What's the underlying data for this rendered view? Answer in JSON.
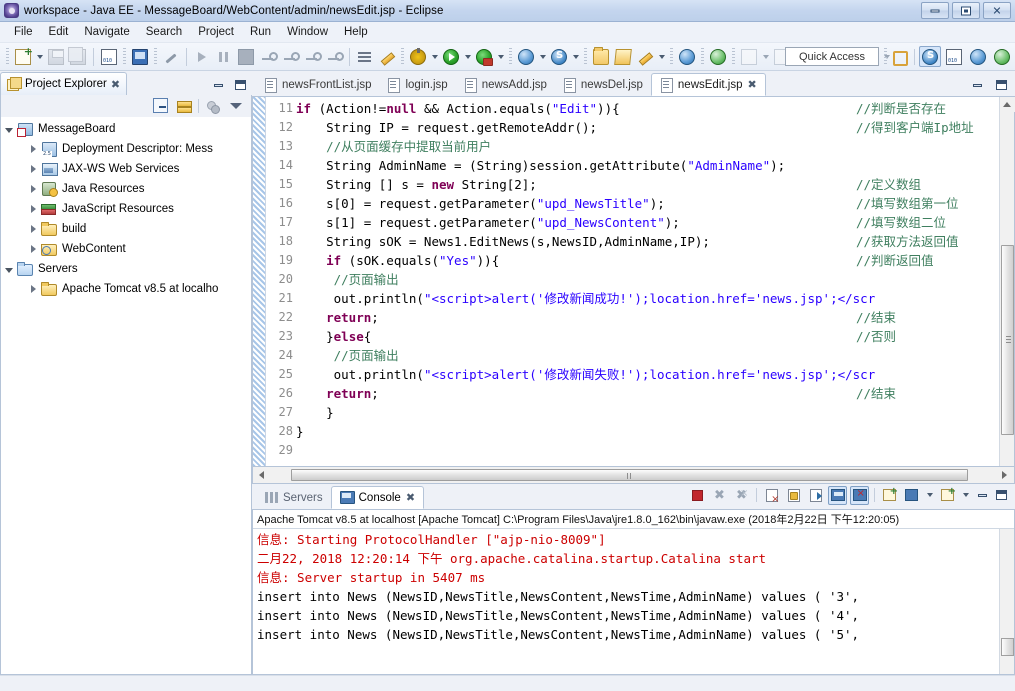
{
  "window": {
    "title": "workspace - Java EE - MessageBoard/WebContent/admin/newsEdit.jsp - Eclipse",
    "app_icon": "eclipse-icon",
    "minimize": "–",
    "maximize": "□",
    "close": "✕"
  },
  "menubar": {
    "items": [
      {
        "label": "File"
      },
      {
        "label": "Edit"
      },
      {
        "label": "Navigate"
      },
      {
        "label": "Search"
      },
      {
        "label": "Project"
      },
      {
        "label": "Run"
      },
      {
        "label": "Window"
      },
      {
        "label": "Help"
      }
    ]
  },
  "toolbar": {
    "quick_access": "Quick Access",
    "icons": [
      "new-wizard-icon",
      "save-icon",
      "save-all-icon",
      "binary-editor-icon",
      "open-console-icon",
      "toggle-breakpoint-icon",
      "resume-icon",
      "suspend-icon",
      "terminate-icon",
      "step-into-icon",
      "step-over-icon",
      "step-return-icon",
      "drop-to-frame-icon",
      "next-annotation-icon",
      "previous-annotation-icon",
      "debug-icon",
      "run-icon",
      "run-server-icon",
      "new-web-project-icon",
      "new-server-icon",
      "open-type-icon",
      "open-task-icon",
      "search-icon",
      "web-browser-icon",
      "run-as-icon",
      "annotation-icon",
      "next-edit-icon",
      "back-icon",
      "forward-icon"
    ],
    "perspective_icons": [
      "open-perspective-icon",
      "java-ee-perspective-icon",
      "java-perspective-icon",
      "debug-perspective-icon",
      "web-perspective-icon"
    ]
  },
  "project_explorer": {
    "tab_label": "Project Explorer",
    "tab_icon": "project-explorer-icon",
    "close_icon": "✖",
    "toolbar_icons": [
      "collapse-all-icon",
      "link-with-editor-icon",
      "filter-icon",
      "view-menu-icon"
    ],
    "tree": [
      {
        "label": "MessageBoard",
        "icon": "project-icon",
        "indent": 0,
        "arrow": "open"
      },
      {
        "label": "Deployment Descriptor: Mess",
        "icon": "deployment-descriptor-icon",
        "indent": 1,
        "arrow": "closed"
      },
      {
        "label": "JAX-WS Web Services",
        "icon": "web-services-icon",
        "indent": 1,
        "arrow": "closed"
      },
      {
        "label": "Java Resources",
        "icon": "java-resources-icon",
        "indent": 1,
        "arrow": "closed"
      },
      {
        "label": "JavaScript Resources",
        "icon": "javascript-resources-icon",
        "indent": 1,
        "arrow": "closed"
      },
      {
        "label": "build",
        "icon": "folder-icon",
        "indent": 1,
        "arrow": "closed"
      },
      {
        "label": "WebContent",
        "icon": "web-folder-icon",
        "indent": 1,
        "arrow": "closed"
      },
      {
        "label": "Servers",
        "icon": "folder-blue-icon",
        "indent": 0,
        "arrow": "open"
      },
      {
        "label": "Apache Tomcat v8.5 at localho",
        "icon": "folder-icon",
        "indent": 1,
        "arrow": "closed"
      }
    ]
  },
  "editor": {
    "tabs": [
      {
        "label": "newsFrontList.jsp",
        "active": false
      },
      {
        "label": "login.jsp",
        "active": false
      },
      {
        "label": "newsAdd.jsp",
        "active": false
      },
      {
        "label": "newsDel.jsp",
        "active": false
      },
      {
        "label": "newsEdit.jsp",
        "active": true
      }
    ],
    "close_icon": "✖",
    "line_numbers": [
      11,
      12,
      13,
      14,
      15,
      16,
      17,
      18,
      19,
      20,
      21,
      22,
      23,
      24,
      25,
      26,
      27,
      28,
      29
    ],
    "lines": [
      {
        "num": 11,
        "segments": [
          {
            "t": "if ",
            "c": "kw"
          },
          {
            "t": "(Action!=",
            "c": "plain"
          },
          {
            "t": "null",
            "c": "kw"
          },
          {
            "t": " && Action.equals(",
            "c": "plain"
          },
          {
            "t": "\"Edit\"",
            "c": "str"
          },
          {
            "t": ")){",
            "c": "plain"
          }
        ],
        "comment": "//判断是否存在"
      },
      {
        "num": 12,
        "segments": [
          {
            "t": "    String IP = request.getRemoteAddr();",
            "c": "plain"
          }
        ],
        "comment": "//得到客户端Ip地址"
      },
      {
        "num": 13,
        "segments": [
          {
            "t": "    //从页面缓存中提取当前用户",
            "c": "cmt"
          }
        ],
        "comment": ""
      },
      {
        "num": 14,
        "segments": [
          {
            "t": "    String AdminName = (String)session.getAttribute(",
            "c": "plain"
          },
          {
            "t": "\"AdminName\"",
            "c": "str"
          },
          {
            "t": ");",
            "c": "plain"
          }
        ],
        "comment": ""
      },
      {
        "num": 15,
        "segments": [
          {
            "t": "    String [] s = ",
            "c": "plain"
          },
          {
            "t": "new",
            "c": "kw"
          },
          {
            "t": " String[2];",
            "c": "plain"
          }
        ],
        "comment": "//定义数组"
      },
      {
        "num": 16,
        "segments": [
          {
            "t": "    s[0] = request.getParameter(",
            "c": "plain"
          },
          {
            "t": "\"upd_NewsTitle\"",
            "c": "str"
          },
          {
            "t": ");",
            "c": "plain"
          }
        ],
        "comment": "//填写数组第一位"
      },
      {
        "num": 17,
        "segments": [
          {
            "t": "    s[1] = request.getParameter(",
            "c": "plain"
          },
          {
            "t": "\"upd_NewsContent\"",
            "c": "str"
          },
          {
            "t": ");",
            "c": "plain"
          }
        ],
        "comment": "//填写数组二位"
      },
      {
        "num": 18,
        "segments": [
          {
            "t": "    String sOK = News1.EditNews(s,NewsID,AdminName,IP);",
            "c": "plain"
          }
        ],
        "comment": "//获取方法返回值"
      },
      {
        "num": 19,
        "segments": [
          {
            "t": "    if",
            "c": "kw"
          },
          {
            "t": " (sOK.equals(",
            "c": "plain"
          },
          {
            "t": "\"Yes\"",
            "c": "str"
          },
          {
            "t": ")){",
            "c": "plain"
          }
        ],
        "comment": "//判断返回值"
      },
      {
        "num": 20,
        "segments": [
          {
            "t": "     //页面输出",
            "c": "cmt"
          }
        ],
        "comment": ""
      },
      {
        "num": 21,
        "segments": [
          {
            "t": "     out.println(",
            "c": "plain"
          },
          {
            "t": "\"<script>alert('修改新闻成功!');location.href='news.jsp';</scr",
            "c": "str"
          }
        ],
        "comment": ""
      },
      {
        "num": 22,
        "segments": [
          {
            "t": "    return",
            "c": "kw"
          },
          {
            "t": ";",
            "c": "plain"
          }
        ],
        "comment": "//结束"
      },
      {
        "num": 23,
        "segments": [
          {
            "t": "    }",
            "c": "plain"
          },
          {
            "t": "else",
            "c": "kw"
          },
          {
            "t": "{",
            "c": "plain"
          }
        ],
        "comment": "//否则"
      },
      {
        "num": 24,
        "segments": [
          {
            "t": "     //页面输出",
            "c": "cmt"
          }
        ],
        "comment": ""
      },
      {
        "num": 25,
        "segments": [
          {
            "t": "     out.println(",
            "c": "plain"
          },
          {
            "t": "\"<script>alert('修改新闻失败!');location.href='news.jsp';</scr",
            "c": "str"
          }
        ],
        "comment": ""
      },
      {
        "num": 26,
        "segments": [
          {
            "t": "    return",
            "c": "kw"
          },
          {
            "t": ";",
            "c": "plain"
          }
        ],
        "comment": "//结束"
      },
      {
        "num": 27,
        "segments": [
          {
            "t": "    }",
            "c": "plain"
          }
        ],
        "comment": ""
      },
      {
        "num": 28,
        "segments": [
          {
            "t": "}",
            "c": "plain"
          }
        ],
        "comment": ""
      },
      {
        "num": 29,
        "segments": [
          {
            "t": "",
            "c": "plain"
          }
        ],
        "comment": ""
      }
    ]
  },
  "console": {
    "tabs": [
      {
        "label": "Servers",
        "icon": "servers-icon",
        "active": false
      },
      {
        "label": "Console",
        "icon": "console-icon",
        "active": true
      }
    ],
    "close_icon": "✖",
    "toolbar_icons": [
      "terminate-icon",
      "remove-launch-icon",
      "remove-all-launches-icon",
      "clear-console-icon",
      "scroll-lock-icon",
      "word-wrap-icon",
      "show-console-icon",
      "display-selected-console-icon",
      "pin-console-icon",
      "open-console-icon",
      "new-console-view-icon"
    ],
    "header": "Apache Tomcat v8.5 at localhost [Apache Tomcat] C:\\Program Files\\Java\\jre1.8.0_162\\bin\\javaw.exe (2018年2月22日 下午12:20:05)",
    "lines": [
      {
        "text": "信息: Starting ProtocolHandler [\"ajp-nio-8009\"]",
        "color": "red"
      },
      {
        "text": "二月22, 2018 12:20:14 下午 org.apache.catalina.startup.Catalina start",
        "color": "red"
      },
      {
        "text": "信息: Server startup in 5407 ms",
        "color": "red"
      },
      {
        "text": "insert into News (NewsID,NewsTitle,NewsContent,NewsTime,AdminName) values ( '3',",
        "color": "black"
      },
      {
        "text": "insert into News (NewsID,NewsTitle,NewsContent,NewsTime,AdminName) values ( '4',",
        "color": "black"
      },
      {
        "text": "insert into News (NewsID,NewsTitle,NewsContent,NewsTime,AdminName) values ( '5',",
        "color": "black"
      }
    ]
  },
  "colors": {
    "keyword": "#7f0055",
    "string": "#2a00ff",
    "comment": "#3f7f5f",
    "console_red": "#cc0000",
    "accent": "#b5c4d8"
  }
}
